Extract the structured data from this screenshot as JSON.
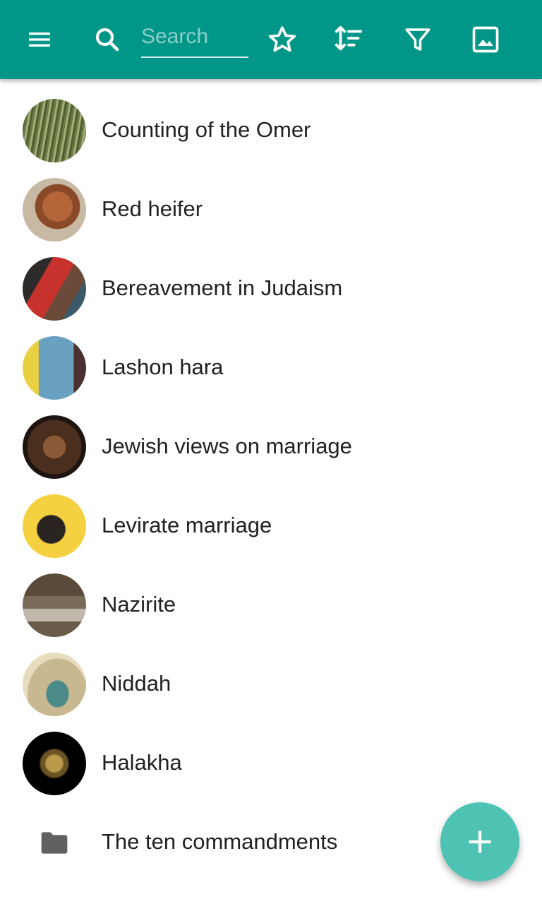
{
  "colors": {
    "appbar": "#009688",
    "fab": "#4fc3b3",
    "text": "#212121",
    "folder": "#616161"
  },
  "toolbar": {
    "menu_icon": "menu-icon",
    "search_icon": "search-icon",
    "search_placeholder": "Search",
    "search_value": "",
    "favorite_icon": "star-outline-icon",
    "sort_icon": "sort-icon",
    "filter_icon": "filter-icon",
    "image_icon": "image-icon"
  },
  "items": [
    {
      "label": "Counting of the Omer",
      "thumb": "image"
    },
    {
      "label": "Red heifer",
      "thumb": "image"
    },
    {
      "label": "Bereavement in Judaism",
      "thumb": "image"
    },
    {
      "label": "Lashon hara",
      "thumb": "image"
    },
    {
      "label": "Jewish views on marriage",
      "thumb": "image"
    },
    {
      "label": "Levirate marriage",
      "thumb": "image"
    },
    {
      "label": "Nazirite",
      "thumb": "image"
    },
    {
      "label": "Niddah",
      "thumb": "image"
    },
    {
      "label": "Halakha",
      "thumb": "image"
    },
    {
      "label": "The ten commandments",
      "thumb": "folder-icon"
    }
  ],
  "fab": {
    "icon": "plus-icon"
  }
}
